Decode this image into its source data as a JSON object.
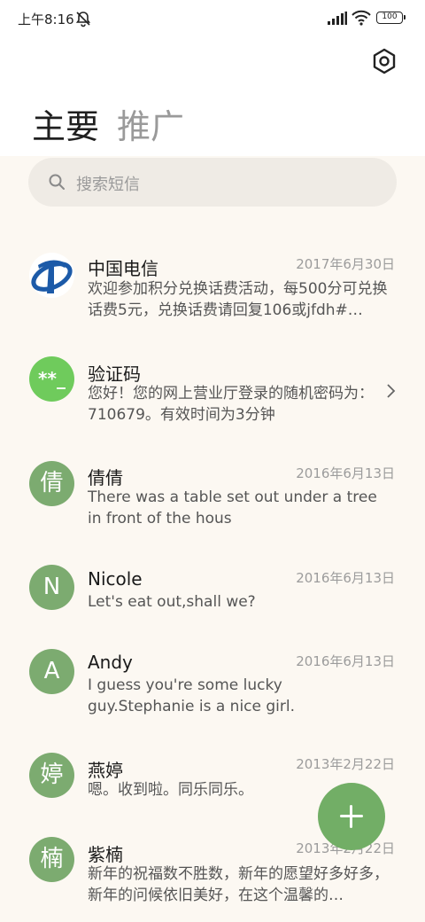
{
  "status_bar": {
    "time": "上午8:16",
    "battery": "100"
  },
  "tabs": [
    {
      "label": "主要",
      "active": true
    },
    {
      "label": "推广",
      "active": false
    }
  ],
  "search": {
    "placeholder": "搜索短信"
  },
  "messages": [
    {
      "sender": "中国电信",
      "date": "2017年6月30日",
      "preview": "欢迎参加积分兑换话费活动，每500分可兑换话费5元，兑换话费请回复106或jfdh#…",
      "avatar": "china-telecom-logo"
    },
    {
      "sender": "验证码",
      "date": "",
      "preview": "您好！您的网上营业厅登录的随机密码为：710679。有效时间为3分钟",
      "avatar": "**_"
    },
    {
      "sender": "倩倩",
      "date": "2016年6月13日",
      "preview": "There was a table set out under a tree in front of the hous",
      "avatar": "倩"
    },
    {
      "sender": "Nicole",
      "date": "2016年6月13日",
      "preview": "Let's eat out,shall we?",
      "avatar": "N"
    },
    {
      "sender": "Andy",
      "date": "2016年6月13日",
      "preview": "I guess you're some lucky guy.Stephanie is a nice girl.",
      "avatar": "A"
    },
    {
      "sender": "燕婷",
      "date": "2013年2月22日",
      "preview": "嗯。收到啦。同乐同乐。",
      "avatar": "婷"
    },
    {
      "sender": "紫楠",
      "date": "2013年2月22日",
      "preview": "新年的祝福数不胜数，新年的愿望好多好多，新年的问候依旧美好，在这个温馨的…",
      "avatar": "楠"
    }
  ],
  "icons": {
    "settings": "settings-hexagon-icon",
    "search": "search-icon",
    "compose": "plus-icon",
    "chevron": "chevron-right-icon"
  },
  "colors": {
    "accent": "#72ae66",
    "avatar": "#7cab70",
    "background": "#fcf8f2"
  }
}
